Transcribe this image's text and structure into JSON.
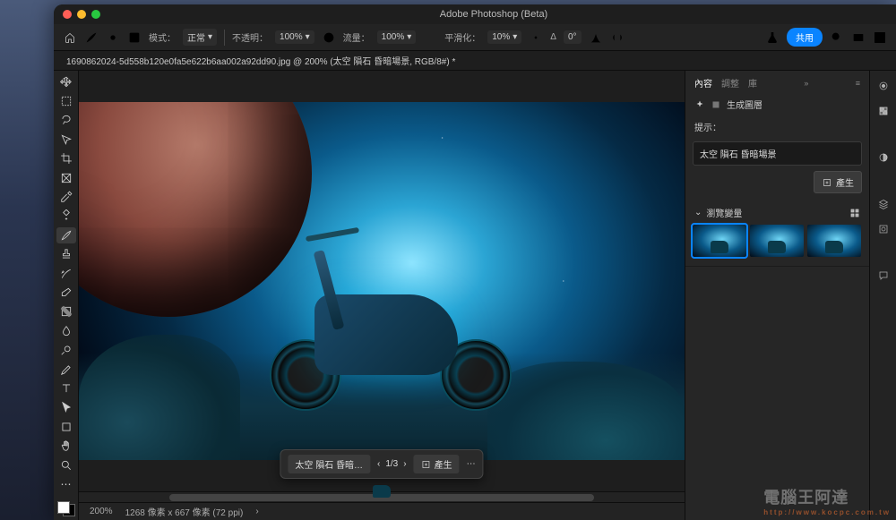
{
  "window": {
    "title": "Adobe Photoshop (Beta)"
  },
  "optbar": {
    "mode_label": "模式：",
    "mode_value": "正常",
    "opacity_label": "不透明：",
    "opacity_value": "100%",
    "flow_label": "流量：",
    "flow_value": "100%",
    "smooth_label": "平滑化：",
    "smooth_value": "10%",
    "angle_label": "Δ",
    "angle_value": "0°",
    "share": "共用"
  },
  "doc": {
    "tab": "1690862024-5d558b120e0fa5e622b6aa002a92dd90.jpg @ 200% (太空 隕石 昏暗場景, RGB/8#) *"
  },
  "ctxbar": {
    "prompt": "太空 隕石 昏暗…",
    "counter": "1/3",
    "generate": "產生"
  },
  "status": {
    "zoom": "200%",
    "info": "1268 像素 x 667 像素 (72 ppi)"
  },
  "panel": {
    "tabs": {
      "content": "內容",
      "adjust": "調整",
      "lib": "庫"
    },
    "gen_layer": "生成圖層",
    "hint_label": "提示：",
    "prompt_value": "太空 隕石 昏暗場景",
    "generate_btn": "產生",
    "variations_label": "瀏覽變量"
  }
}
